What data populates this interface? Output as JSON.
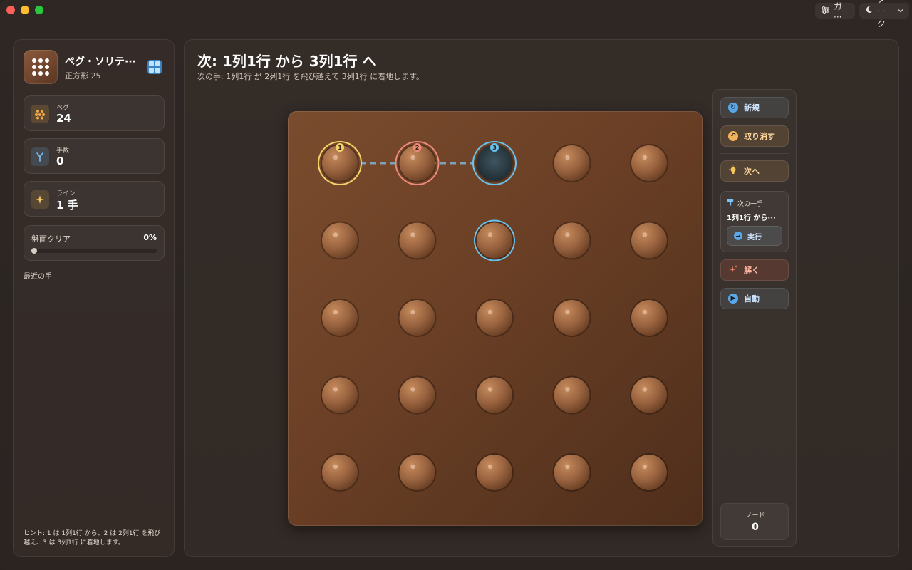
{
  "titlebar": {
    "display_button": "ガ···",
    "theme_button": "ダーク"
  },
  "sidebar": {
    "app_title": "ペグ・ソリテ···",
    "app_subtitle": "正方形 25",
    "stats": [
      {
        "label": "ペグ",
        "value": "24"
      },
      {
        "label": "手数",
        "value": "0"
      },
      {
        "label": "ライン",
        "value": "1 手"
      }
    ],
    "progress": {
      "label": "盤面クリア",
      "percent_text": "0%",
      "fraction": 0
    },
    "recent_label": "最近の手",
    "hint": "ヒント: 1 は 1列1行 から、2 は 2列1行 を飛び越え、3 は 3列1行 に着地します。"
  },
  "main": {
    "title": "次: 1列1行 から 3列1行 へ",
    "subtitle": "次の手: 1列1行 が 2列1行 を飛び越えて 3列1行 に着地します。"
  },
  "board": {
    "rows": 5,
    "cols": 5,
    "empty": [
      [
        0,
        2
      ]
    ],
    "markers": [
      {
        "row": 0,
        "col": 0,
        "label": "1",
        "color": "#f5d36a"
      },
      {
        "row": 0,
        "col": 1,
        "label": "2",
        "color": "#f08a7a"
      },
      {
        "row": 0,
        "col": 2,
        "label": "3",
        "color": "#66c3ee"
      }
    ],
    "selected_ring": {
      "row": 1,
      "col": 2,
      "color": "#66c3ee"
    },
    "path_color": "#7fb3d6"
  },
  "controls": {
    "new_label": "新規",
    "undo_label": "取り消す",
    "next_label": "次へ",
    "next_card_title": "次の一手",
    "next_card_move": "1列1行 から···",
    "execute_label": "実行",
    "solve_label": "解く",
    "auto_label": "自動",
    "node_label": "ノード",
    "node_value": "0"
  }
}
